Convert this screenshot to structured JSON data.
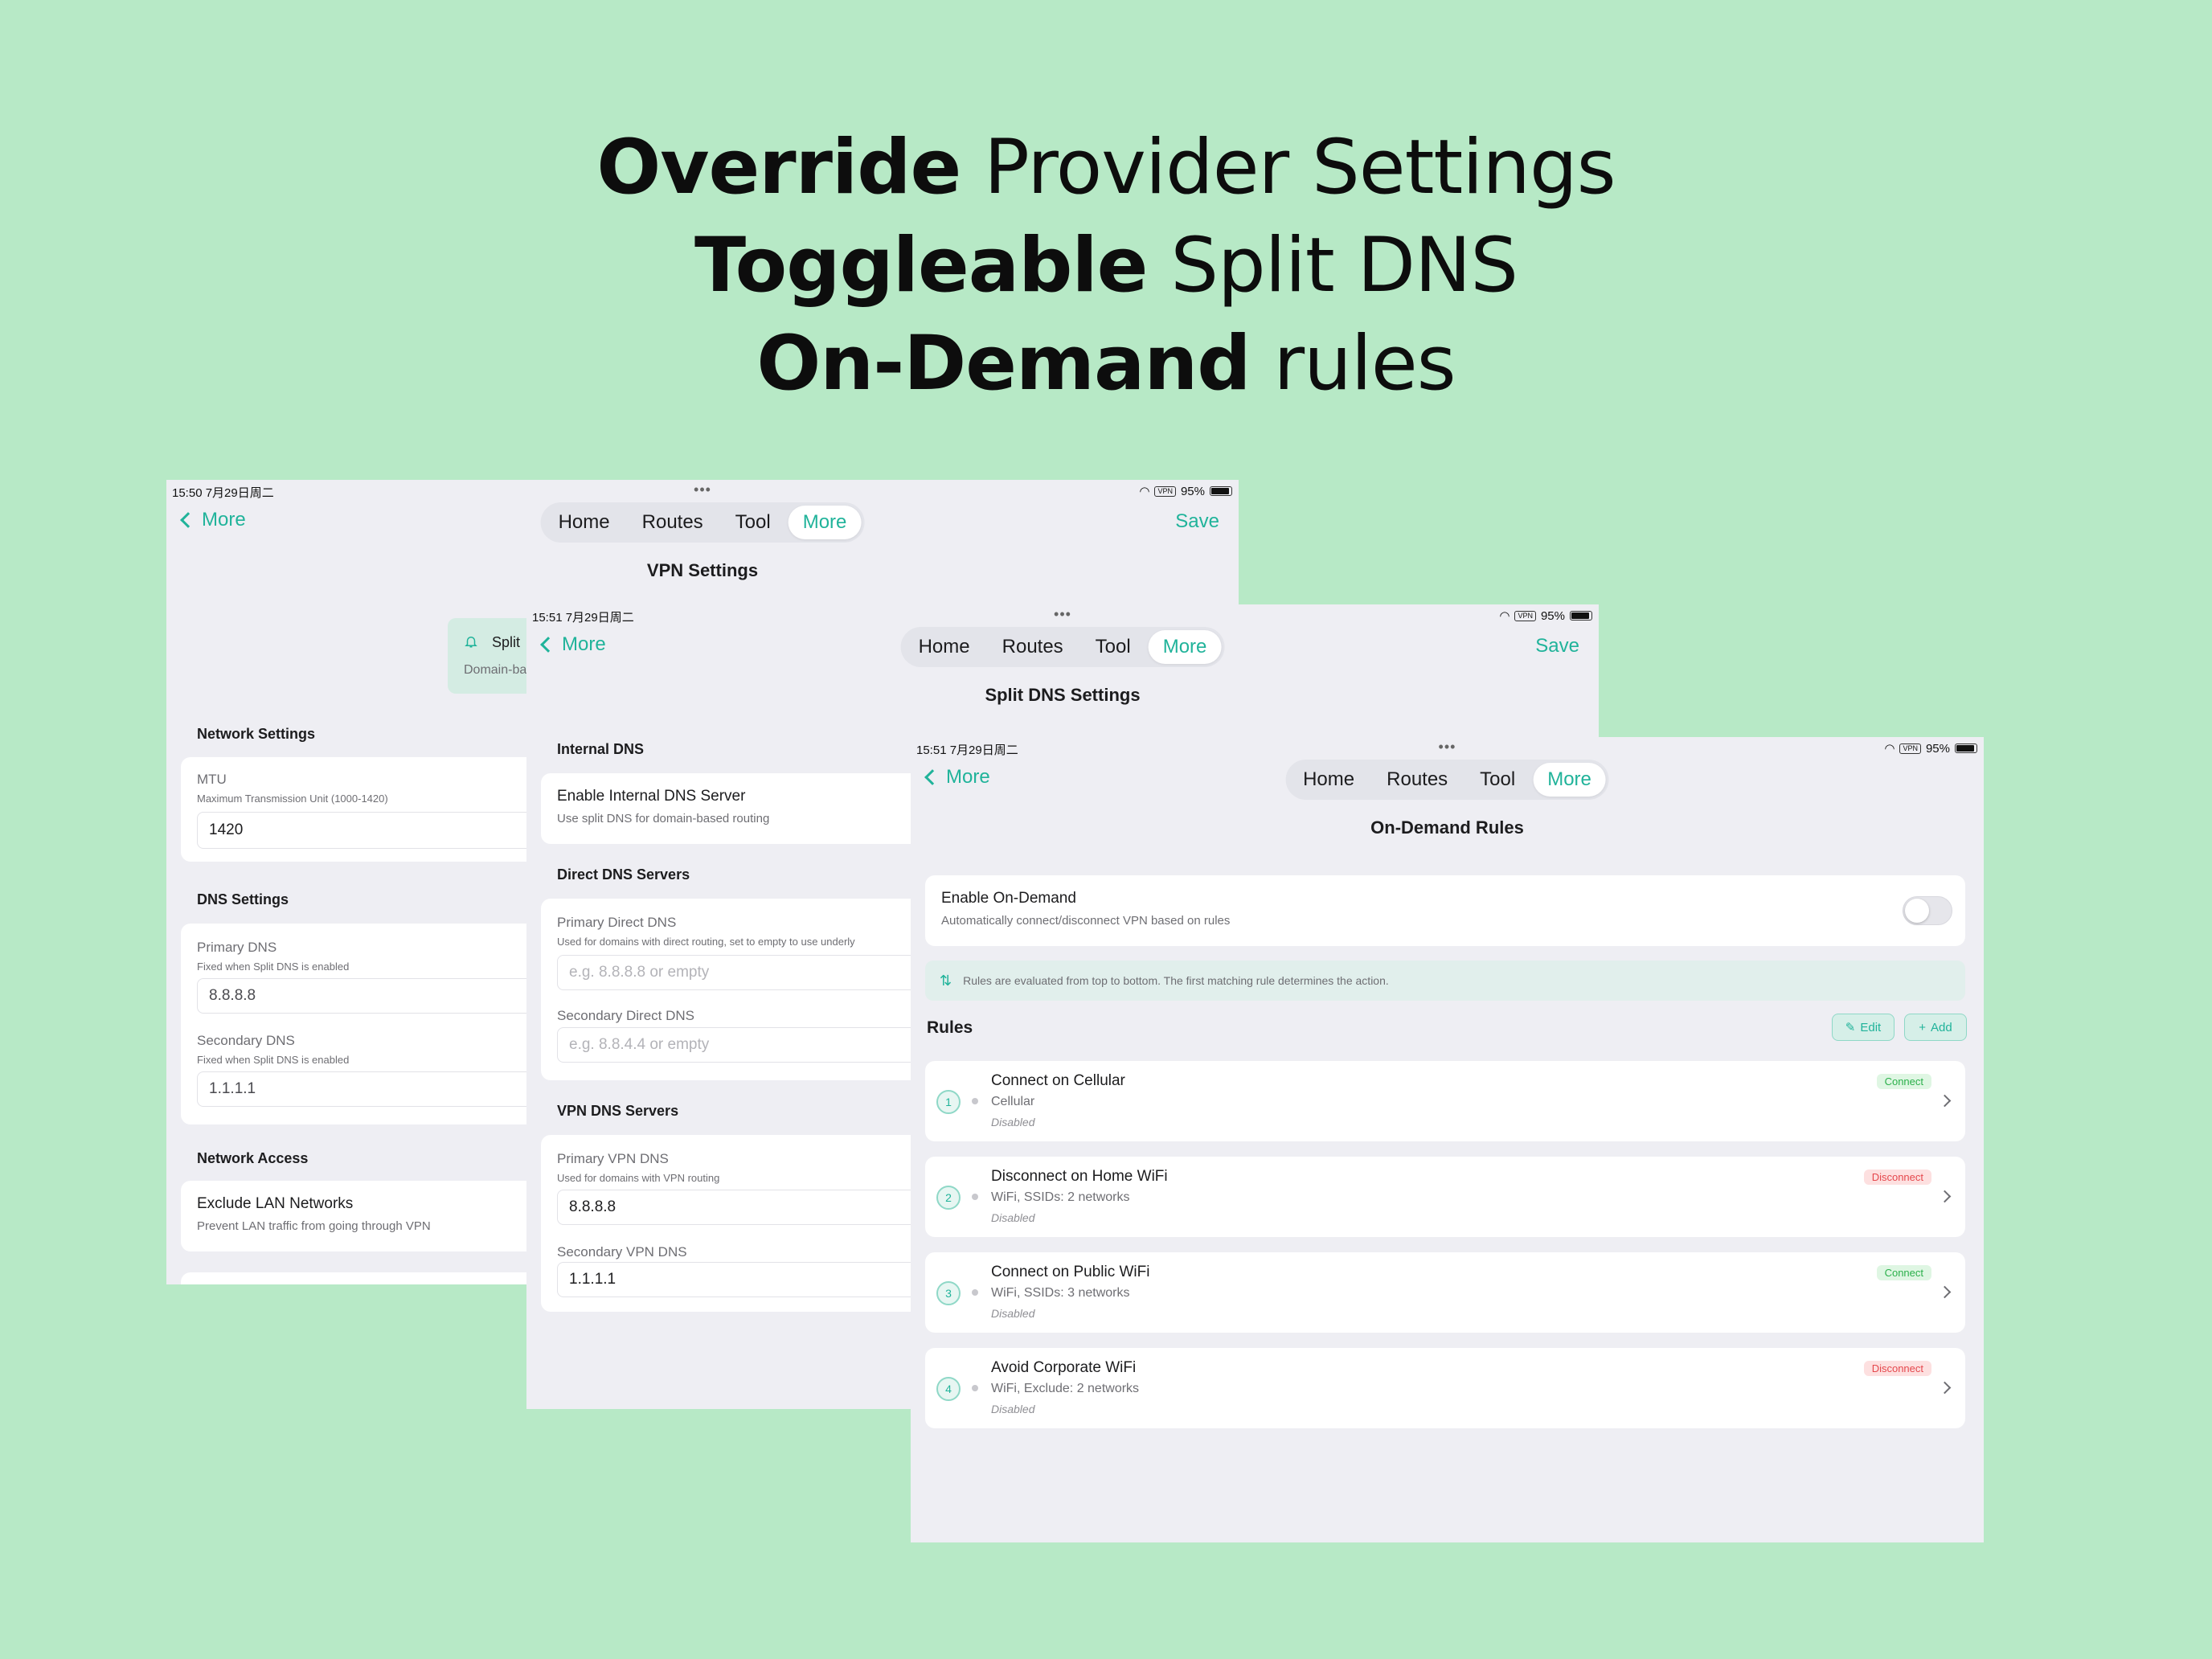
{
  "headline": {
    "line1_bold": "Override",
    "line1_rest": " Provider Settings",
    "line2_bold": "Toggleable",
    "line2_rest": " Split DNS",
    "line3_bold": "On-Demand",
    "line3_rest": " rules"
  },
  "status_bar": {
    "screen1_time": "15:50  7月29日周二",
    "screen2_time": "15:51  7月29日周二",
    "screen3_time": "15:51  7月29日周二",
    "vpn_label": "VPN",
    "battery": "95%"
  },
  "nav": {
    "back_label": "More",
    "save_label": "Save",
    "tabs": [
      "Home",
      "Routes",
      "Tool",
      "More"
    ]
  },
  "vpn_settings": {
    "title": "VPN Settings",
    "split_card": {
      "title": "Split",
      "subtitle": "Domain-ba"
    },
    "network_settings": {
      "header": "Network Settings",
      "mtu_label": "MTU",
      "mtu_hint": "Maximum Transmission Unit (1000-1420)",
      "mtu_value": "1420"
    },
    "dns_settings": {
      "header": "DNS Settings",
      "primary_label": "Primary DNS",
      "primary_hint": "Fixed when Split DNS is enabled",
      "primary_value": "8.8.8.8",
      "secondary_label": "Secondary DNS",
      "secondary_hint": "Fixed when Split DNS is enabled",
      "secondary_value": "1.1.1.1"
    },
    "network_access": {
      "header": "Network Access",
      "exclude_title": "Exclude LAN Networks",
      "exclude_sub": "Prevent LAN traffic from going through VPN"
    }
  },
  "split_dns": {
    "title": "Split DNS Settings",
    "internal": {
      "header": "Internal DNS",
      "enable_title": "Enable Internal DNS Server",
      "enable_sub": "Use split DNS for domain-based routing"
    },
    "direct": {
      "header": "Direct DNS Servers",
      "primary_label": "Primary Direct DNS",
      "primary_hint": "Used for domains with direct routing, set to empty to use underly",
      "primary_placeholder": "e.g. 8.8.8.8 or empty",
      "secondary_label": "Secondary Direct DNS",
      "secondary_placeholder": "e.g. 8.8.4.4 or empty"
    },
    "vpn": {
      "header": "VPN DNS Servers",
      "primary_label": "Primary VPN DNS",
      "primary_hint": "Used for domains with VPN routing",
      "primary_value": "8.8.8.8",
      "secondary_label": "Secondary VPN DNS",
      "secondary_value": "1.1.1.1"
    }
  },
  "on_demand": {
    "title": "On-Demand Rules",
    "enable_title": "Enable On-Demand",
    "enable_sub": "Automatically connect/disconnect VPN based on rules",
    "enabled": false,
    "info": "Rules are evaluated from top to bottom. The first matching rule determines the action.",
    "rules_header": "Rules",
    "edit_label": "Edit",
    "add_label": "Add",
    "rules": [
      {
        "num": "1",
        "title": "Connect on Cellular",
        "sub": "Cellular",
        "state": "Disabled",
        "action": "Connect"
      },
      {
        "num": "2",
        "title": "Disconnect on Home WiFi",
        "sub": "WiFi, SSIDs: 2 networks",
        "state": "Disabled",
        "action": "Disconnect"
      },
      {
        "num": "3",
        "title": "Connect on Public WiFi",
        "sub": "WiFi, SSIDs: 3 networks",
        "state": "Disabled",
        "action": "Connect"
      },
      {
        "num": "4",
        "title": "Avoid Corporate WiFi",
        "sub": "WiFi, Exclude: 2 networks",
        "state": "Disabled",
        "action": "Disconnect"
      }
    ]
  },
  "colors": {
    "accent": "#20b39a",
    "background": "#b7e9c6",
    "connect": "#2bb04b",
    "disconnect": "#e5484d"
  }
}
